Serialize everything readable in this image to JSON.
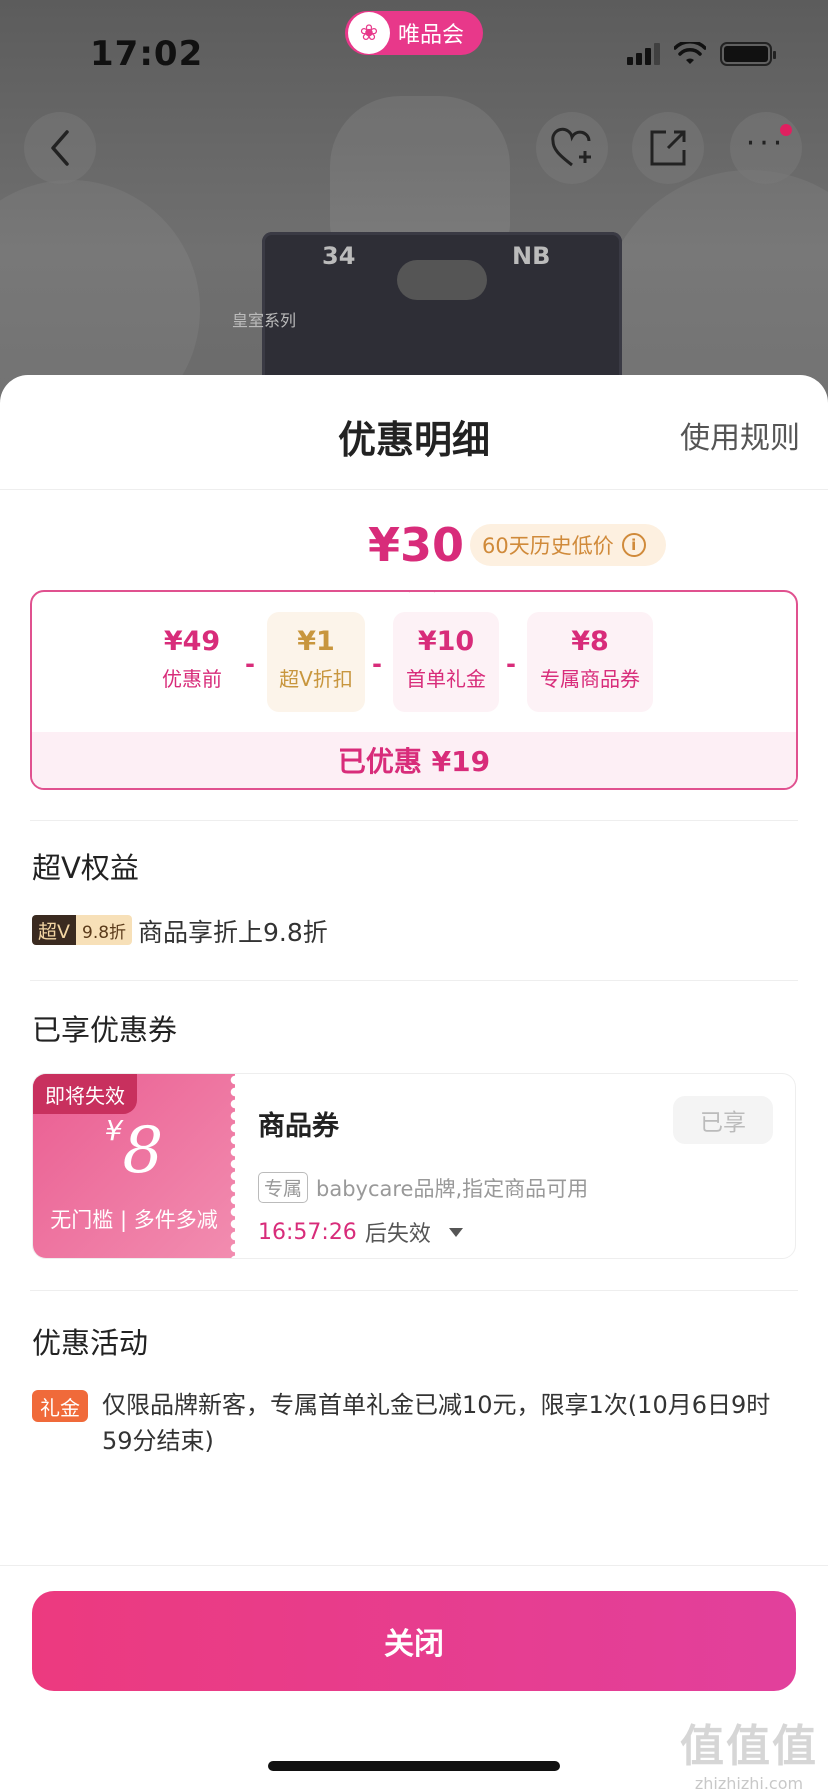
{
  "status_bar": {
    "time": "17:02",
    "app_name": "唯品会"
  },
  "nav": {
    "back_icon": "chevron-left-icon",
    "favorite_icon": "heart-plus-icon",
    "share_icon": "share-icon",
    "more_icon": "more-dots-icon"
  },
  "product_labels": {
    "count": "34",
    "size": "NB",
    "series": "皇室系列"
  },
  "sheet": {
    "title": "优惠明细",
    "rules_link": "使用规则"
  },
  "price": {
    "final": "¥30",
    "history_badge": "60天历史低价"
  },
  "breakdown": {
    "items": [
      {
        "value": "¥49",
        "label": "优惠前"
      },
      {
        "value": "¥1",
        "label": "超V折扣"
      },
      {
        "value": "¥10",
        "label": "首单礼金"
      },
      {
        "value": "¥8",
        "label": "专属商品券"
      }
    ],
    "minus": "-",
    "total": "已优惠 ¥19"
  },
  "svip": {
    "section_title": "超V权益",
    "tag_a": "超V",
    "tag_b": "9.8折",
    "text": "商品享折上9.8折"
  },
  "coupons": {
    "section_title": "已享优惠券",
    "item": {
      "expiring_label": "即将失效",
      "currency": "¥",
      "amount": "8",
      "condition": "无门槛 | 多件多减",
      "name": "商品券",
      "status": "已享",
      "exclusive_tag": "专属",
      "desc": "babycare品牌,指定商品可用",
      "countdown": "16:57:26",
      "expire_suffix": "后失效"
    }
  },
  "activity": {
    "section_title": "优惠活动",
    "tag": "礼金",
    "text": "仅限品牌新客，专属首单礼金已减10元，限享1次(10月6日9时59分结束)"
  },
  "footer": {
    "close_label": "关闭"
  },
  "watermark": {
    "logo": "值值值",
    "url": "zhizhizhi.com"
  },
  "colors": {
    "accent": "#d82c7a",
    "button_gradient_start": "#ec3a7f",
    "button_gradient_end": "#e2409c",
    "gold": "#d08a3a"
  }
}
